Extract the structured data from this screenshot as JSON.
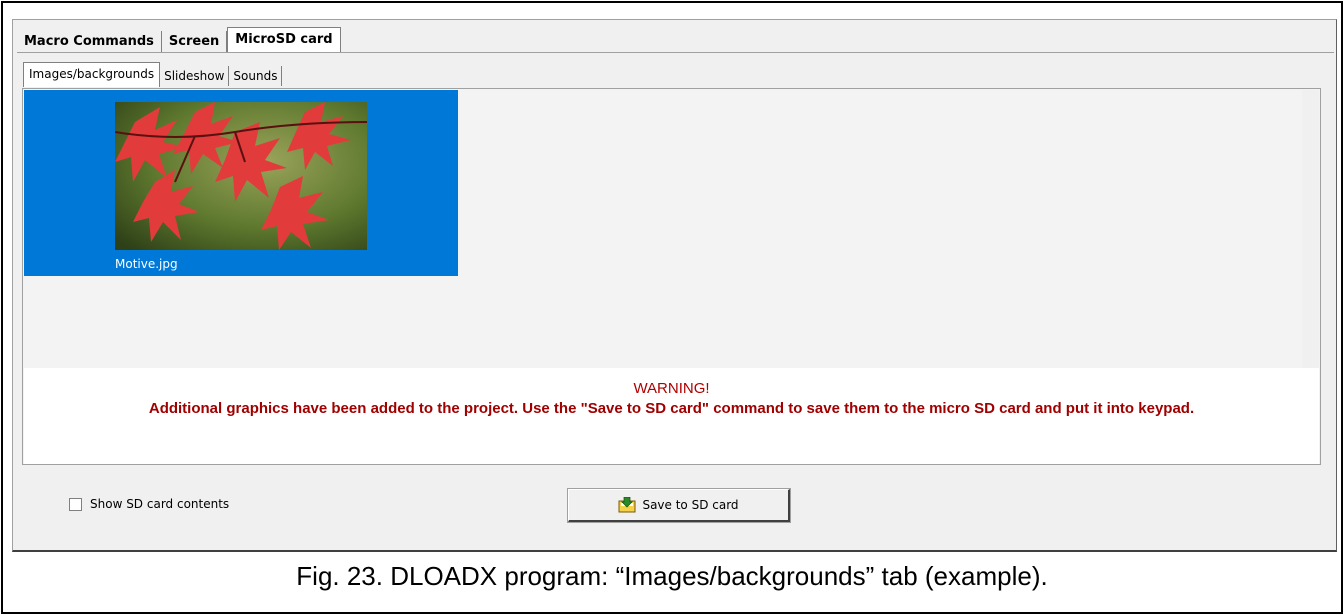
{
  "tabs_top": [
    "Macro Commands",
    "Screen",
    "MicroSD card"
  ],
  "tabs_sub": [
    "Images/backgrounds",
    "Slideshow",
    "Sounds"
  ],
  "image_item": {
    "name": "Motive.jpg"
  },
  "warning": {
    "title": "WARNING!",
    "text": "Additional graphics have been added to the project. Use the \"Save to SD card\" command to save them to the micro SD card and put it into keypad."
  },
  "checkbox": {
    "label": "Show SD card contents",
    "checked": false
  },
  "button": {
    "label": "Save to SD card",
    "icon": "save-to-sd-icon"
  },
  "caption": "Fig. 23. DLOADX program: “Images/backgrounds” tab (example).",
  "colors": {
    "selection": "#0078d7",
    "warning_text": "#a00000"
  }
}
